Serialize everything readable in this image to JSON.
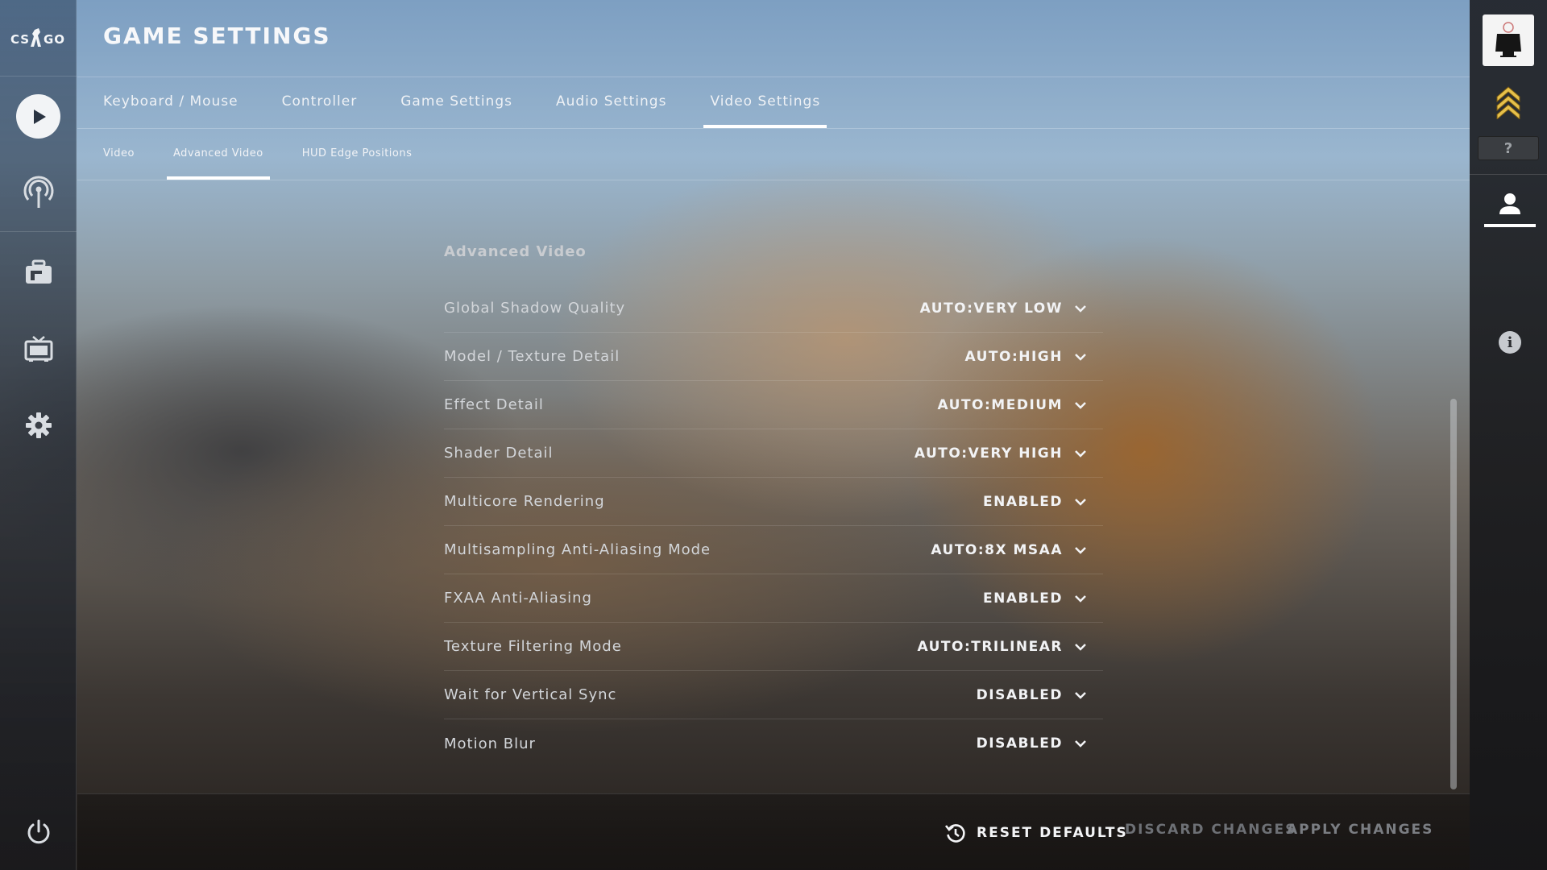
{
  "app": {
    "logo_text": "CS GO"
  },
  "left_nav": {
    "items": [
      {
        "name": "play",
        "icon": "play-icon"
      },
      {
        "name": "watch",
        "icon": "broadcast-icon"
      },
      {
        "name": "inventory",
        "icon": "briefcase-icon"
      },
      {
        "name": "tv",
        "icon": "tv-icon"
      },
      {
        "name": "settings",
        "icon": "gear-icon"
      }
    ],
    "power_icon": "power-icon"
  },
  "header": {
    "title": "GAME SETTINGS"
  },
  "tabs": [
    {
      "label": "Keyboard / Mouse",
      "active": false
    },
    {
      "label": "Controller",
      "active": false
    },
    {
      "label": "Game Settings",
      "active": false
    },
    {
      "label": "Audio Settings",
      "active": false
    },
    {
      "label": "Video Settings",
      "active": true
    }
  ],
  "subtabs": [
    {
      "label": "Video",
      "active": false
    },
    {
      "label": "Advanced Video",
      "active": true
    },
    {
      "label": "HUD Edge Positions",
      "active": false
    }
  ],
  "section": {
    "title": "Advanced Video",
    "rows": [
      {
        "label": "Global Shadow Quality",
        "value": "AUTO:VERY LOW"
      },
      {
        "label": "Model / Texture Detail",
        "value": "AUTO:HIGH"
      },
      {
        "label": "Effect Detail",
        "value": "AUTO:MEDIUM"
      },
      {
        "label": "Shader Detail",
        "value": "AUTO:VERY HIGH"
      },
      {
        "label": "Multicore Rendering",
        "value": "ENABLED"
      },
      {
        "label": "Multisampling Anti-Aliasing Mode",
        "value": "AUTO:8X MSAA"
      },
      {
        "label": "FXAA Anti-Aliasing",
        "value": "ENABLED"
      },
      {
        "label": "Texture Filtering Mode",
        "value": "AUTO:TRILINEAR"
      },
      {
        "label": "Wait for Vertical Sync",
        "value": "DISABLED"
      },
      {
        "label": "Motion Blur",
        "value": "DISABLED"
      }
    ]
  },
  "footer": {
    "reset_label": "RESET DEFAULTS",
    "discard_label": "DISCARD CHANGES",
    "apply_label": "APPLY CHANGES"
  },
  "right_bar": {
    "rank_unknown_text": "?",
    "info_text": "i"
  },
  "colors": {
    "active_text": "#f2f3f5",
    "disabled_text": "#6d7075",
    "label_text": "#d3d6da"
  }
}
